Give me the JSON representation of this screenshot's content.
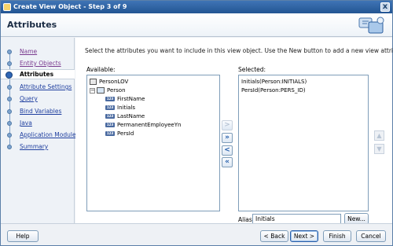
{
  "window": {
    "title": "Create View Object - Step 3 of 9",
    "close_label": "x"
  },
  "header": {
    "title": "Attributes"
  },
  "nav": {
    "items": [
      {
        "label": "Name",
        "state": "visited"
      },
      {
        "label": "Entity Objects",
        "state": "visited"
      },
      {
        "label": "Attributes",
        "state": "current"
      },
      {
        "label": "Attribute Settings",
        "state": "link"
      },
      {
        "label": "Query",
        "state": "link"
      },
      {
        "label": "Bind Variables",
        "state": "link"
      },
      {
        "label": "Java",
        "state": "link"
      },
      {
        "label": "Application Module",
        "state": "link"
      },
      {
        "label": "Summary",
        "state": "link"
      }
    ]
  },
  "main": {
    "instructions": "Select the attributes you want to include in this view object.  Use the New button to add a new view attribute.",
    "available_label": "Available:",
    "selected_label": "Selected:",
    "available_tree": {
      "root": "PersonLOV",
      "entity": "Person",
      "attributes": [
        "FirstName",
        "Initials",
        "LastName",
        "PermanentEmployeeYn",
        "PersId"
      ]
    },
    "selected_items": [
      "Initials(Person:INITIALS)",
      "PersId(Person:PERS_ID)"
    ],
    "shuttle": {
      "add": ">",
      "add_all": "»",
      "remove": "<",
      "remove_all": "«"
    },
    "alias_label": "Alias:",
    "alias_value": "Initials",
    "new_button": "New..."
  },
  "footer": {
    "help": "Help",
    "back": "< Back",
    "next": "Next >",
    "finish": "Finish",
    "cancel": "Cancel"
  }
}
